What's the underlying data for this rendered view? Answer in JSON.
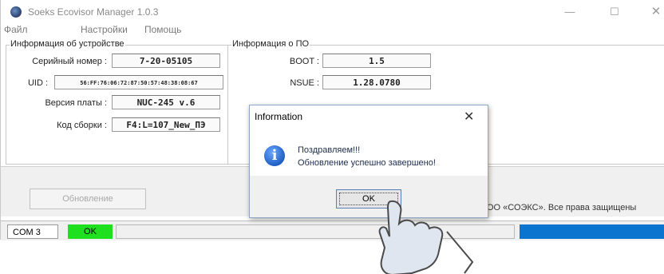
{
  "window": {
    "title": "Soeks Ecovisor Manager 1.0.3",
    "controls": {
      "minimize": "—",
      "maximize": "☐",
      "close": "✕"
    }
  },
  "menu": {
    "items": [
      "Файл",
      "Настройки",
      "Помощь"
    ]
  },
  "device_info": {
    "legend": "Информация об устройстве",
    "serial_label": "Серийный номер :",
    "serial_value": "7-20-05105",
    "uid_label": "UID :",
    "uid_value": "56:FF:76:06:72:87:50:57:48:38:08:67",
    "board_label": "Версия платы :",
    "board_value": "NUC-245 v.6",
    "build_label": "Код сборки :",
    "build_value": "F4:L=107_New_ПЭ"
  },
  "software_info": {
    "legend": "Информация о ПО",
    "boot_label": "BOOT :",
    "boot_value": "1.5",
    "nsue_label": "NSUE :",
    "nsue_value": "1.28.0780"
  },
  "update_button": "Обновление",
  "copyright": "Р ООО «СОЭКС». Все права защищены",
  "status": {
    "port": "COM 3",
    "state": "OK",
    "colors": {
      "ok": "#1fe01f",
      "progress": "#0a74cf"
    }
  },
  "dialog": {
    "title": "Information",
    "close": "✕",
    "icon": "info-icon",
    "line1": "Поздравляем!!!",
    "line2": "Обновление успешно завершено!",
    "ok": "OK"
  }
}
